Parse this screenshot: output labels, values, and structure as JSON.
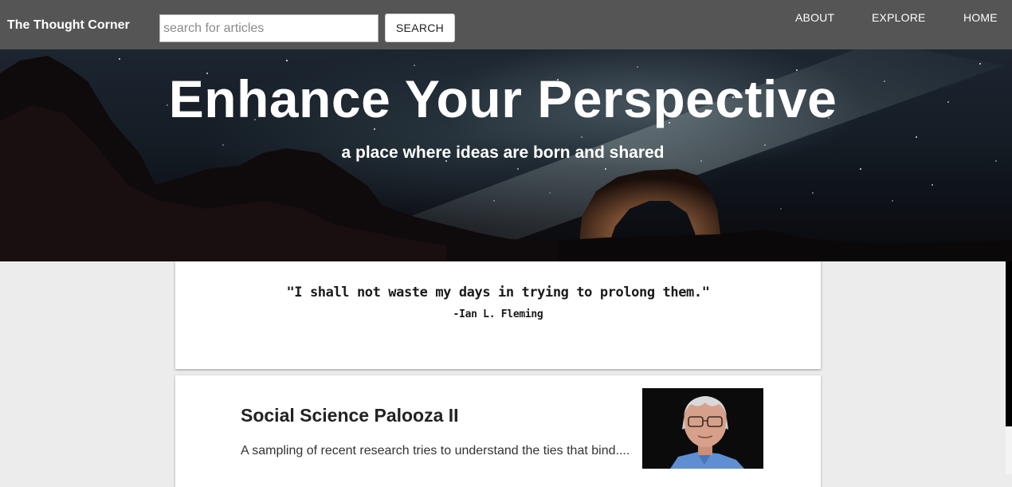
{
  "nav": {
    "brand": "The Thought Corner",
    "search_placeholder": "search for articles",
    "search_value": "",
    "search_button": "SEARCH",
    "links": [
      "ABOUT",
      "EXPLORE",
      "HOME"
    ]
  },
  "hero": {
    "title": "Enhance Your Perspective",
    "subtitle": "a place where ideas are born and shared"
  },
  "quote": {
    "text": "\"I shall not waste my days in trying to prolong them.\"",
    "author": "-Ian L. Fleming"
  },
  "articles": [
    {
      "title": "Social Science Palooza II",
      "excerpt": "A sampling of recent research tries to understand the ties that bind....",
      "thumbnail": "author-portrait"
    }
  ],
  "colors": {
    "nav_bg": "#555555",
    "page_bg": "#ececec",
    "card_bg": "#ffffff",
    "text_dark": "#222222"
  }
}
